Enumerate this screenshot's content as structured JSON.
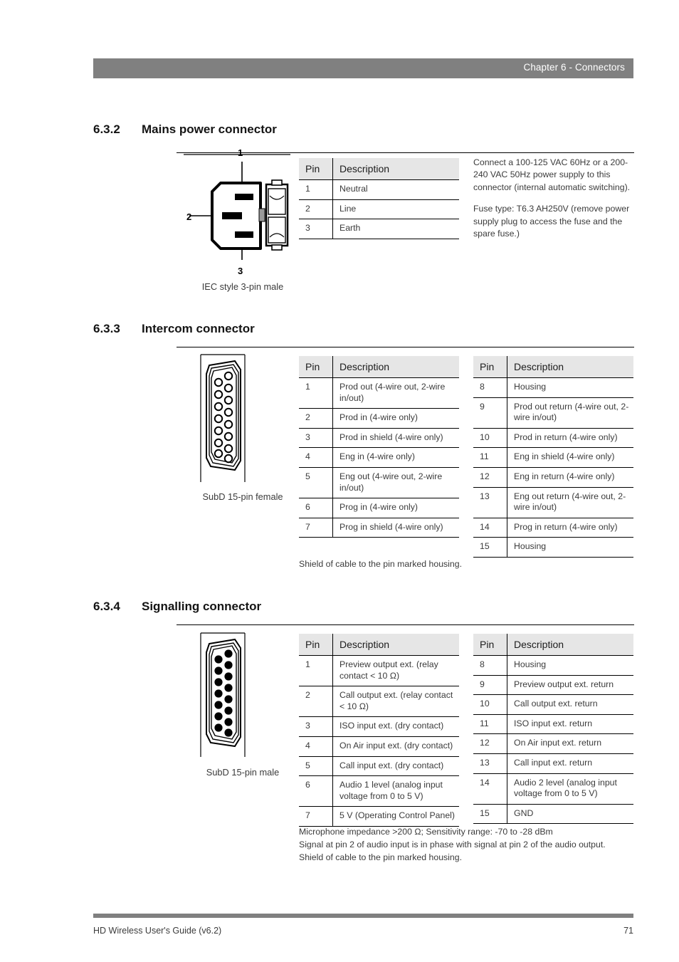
{
  "header": {
    "chapter": "Chapter 6 - Connectors"
  },
  "footer": {
    "doc_title": "HD Wireless User's Guide (v6.2)",
    "page_number": "71"
  },
  "sections": [
    {
      "number": "6.3.2",
      "title": "Mains power connector",
      "figure_caption": "IEC style 3-pin male",
      "figure_labels": [
        "1",
        "2",
        "3"
      ],
      "table": {
        "headers": [
          "Pin",
          "Description"
        ],
        "rows": [
          [
            "1",
            "Neutral"
          ],
          [
            "2",
            "Line"
          ],
          [
            "3",
            "Earth"
          ]
        ]
      },
      "notes": [
        "Connect a 100-125 VAC 60Hz or a 200-240 VAC 50Hz power supply to this connector (internal automatic switching).",
        "Fuse type: T6.3 AH250V (remove power supply plug to access the  fuse and the spare fuse.)"
      ]
    },
    {
      "number": "6.3.3",
      "title": "Intercom connector",
      "figure_caption": "SubD 15-pin female",
      "table_left": {
        "headers": [
          "Pin",
          "Description"
        ],
        "rows": [
          [
            "1",
            "Prod out (4-wire out, 2-wire in/out)"
          ],
          [
            "2",
            "Prod in (4-wire only)"
          ],
          [
            "3",
            "Prod in shield (4-wire only)"
          ],
          [
            "4",
            "Eng in (4-wire only)"
          ],
          [
            "5",
            "Eng out (4-wire out, 2-wire in/out)"
          ],
          [
            "6",
            "Prog in (4-wire only)"
          ],
          [
            "7",
            "Prog in shield (4-wire only)"
          ]
        ]
      },
      "table_right": {
        "headers": [
          "Pin",
          "Description"
        ],
        "rows": [
          [
            "8",
            "Housing"
          ],
          [
            "9",
            "Prod out return (4-wire out, 2-wire in/out)"
          ],
          [
            "10",
            "Prod in return (4-wire only)"
          ],
          [
            "11",
            "Eng in shield (4-wire only)"
          ],
          [
            "12",
            "Eng in return (4-wire only)"
          ],
          [
            "13",
            "Eng out return (4-wire out, 2-wire in/out)"
          ],
          [
            "14",
            "Prog in return (4-wire only)"
          ],
          [
            "15",
            "Housing"
          ]
        ]
      },
      "footnotes": [
        "Shield of cable to the pin marked housing."
      ]
    },
    {
      "number": "6.3.4",
      "title": "Signalling connector",
      "figure_caption": "SubD 15-pin male",
      "table_left": {
        "headers": [
          "Pin",
          "Description"
        ],
        "rows": [
          [
            "1",
            "Preview output ext. (relay contact < 10 Ω)"
          ],
          [
            "2",
            "Call output ext. (relay contact < 10 Ω)"
          ],
          [
            "3",
            "ISO input ext. (dry contact)"
          ],
          [
            "4",
            "On Air input ext. (dry contact)"
          ],
          [
            "5",
            "Call input ext. (dry contact)"
          ],
          [
            "6",
            "Audio 1 level (analog input voltage from 0 to 5 V)"
          ],
          [
            "7",
            "5 V (Operating Control Panel)"
          ]
        ]
      },
      "table_right": {
        "headers": [
          "Pin",
          "Description"
        ],
        "rows": [
          [
            "8",
            "Housing"
          ],
          [
            "9",
            "Preview output ext. return"
          ],
          [
            "10",
            "Call output ext. return"
          ],
          [
            "11",
            "ISO input ext. return"
          ],
          [
            "12",
            "On Air input ext. return"
          ],
          [
            "13",
            "Call input ext. return"
          ],
          [
            "14",
            "Audio 2 level (analog input voltage from 0 to 5 V)"
          ],
          [
            "15",
            "GND"
          ]
        ]
      },
      "footnotes": [
        "Microphone impedance >200 Ω; Sensitivity range: -70 to -28 dBm",
        "Signal at pin 2 of audio input is in phase with signal at pin 2 of the audio output.",
        "Shield of cable to the pin marked housing."
      ]
    }
  ],
  "colors": {
    "header_bar": "#808080",
    "table_header": "#e6e6e6",
    "rule": "#000000",
    "text": "#3b3b3b"
  }
}
